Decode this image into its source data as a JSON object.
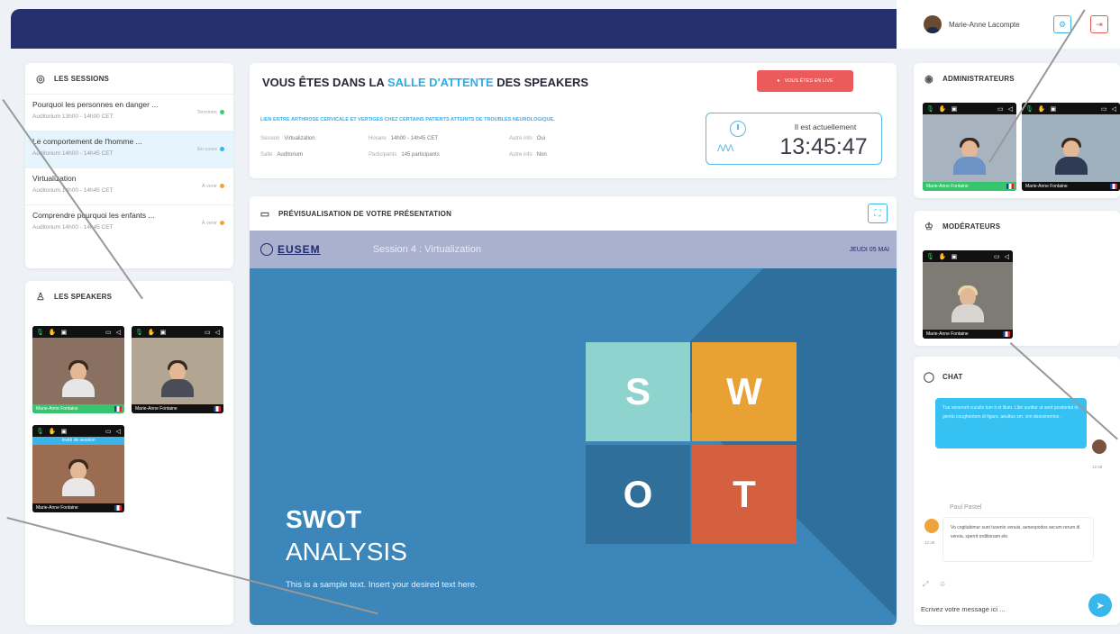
{
  "user": {
    "name": "Marie-Anne Lacompte"
  },
  "sessions": {
    "title": "LES SESSIONS",
    "items": [
      {
        "title": "Pourquoi les personnes en danger ...",
        "meta": "Auditorium  13h00 - 14h00 CET",
        "status": "Terminée",
        "status_color": "#3dc97d"
      },
      {
        "title": "Le comportement de l'homme ...",
        "meta": "Auditorium  14h00 - 14h45 CET",
        "status": "En cours",
        "status_color": "#3ab4e6"
      },
      {
        "title": "Virtualization",
        "meta": "Auditorium  14h00 - 14h45 CET",
        "status": "À venir",
        "status_color": "#f0a33a"
      },
      {
        "title": "Comprendre pourquoi les enfants ...",
        "meta": "Auditorium  14h00 - 14h45 CET",
        "status": "À venir",
        "status_color": "#f0a33a"
      }
    ]
  },
  "speakers": {
    "title": "LES SPEAKERS",
    "tiles": [
      {
        "name": "Marie-Anne Fontaine",
        "highlight": true
      },
      {
        "name": "Marie-Anne Fontaine",
        "highlight": false
      },
      {
        "name": "Marie-Anne Fontaine",
        "highlight": false,
        "top_label": "Invité de session"
      }
    ]
  },
  "main": {
    "title_pre": "VOUS ÊTES DANS LA ",
    "title_highlight": "SALLE D'ATTENTE",
    "title_post": " DES SPEAKERS",
    "live_button": "VOUS ÊTES EN LIVE",
    "topic": "LIEN ENTRE ARTHROSE CERVICALE ET VERTIGES CHEZ CERTAINS PATIENTS ATTEINTS DE TROUBLES NEUROLOGIQUE.",
    "meta": [
      {
        "label": "Session",
        "value": "Virtualization"
      },
      {
        "label": "Horaire",
        "value": "14h00 - 14h45 CET"
      },
      {
        "label": "Autre info",
        "value": "Oui"
      },
      {
        "label": "Salle",
        "value": "Auditorium"
      },
      {
        "label": "Participants",
        "value": "145 participants"
      },
      {
        "label": "Autre info",
        "value": "Non"
      }
    ],
    "clock_label": "Il est actuellement",
    "clock_time": "13:45:47"
  },
  "preview": {
    "title": "PRÉVISUALISATION DE VOTRE PRÉSENTATION",
    "logo": "EUSEM",
    "session_name": "Session 4 : Virtualization",
    "date": "JEUDI 05 MAI",
    "slide_title1": "SWOT",
    "slide_title2": "ANALYSIS",
    "slide_text": "This is a sample text. Insert your desired text here.",
    "letters": [
      "S",
      "W",
      "O",
      "T"
    ],
    "colors": [
      "#8ed3cd",
      "#e8a234",
      "#2f6f9a",
      "#d4603f"
    ]
  },
  "admins": {
    "title": "ADMINISTRATEURS",
    "tiles": [
      {
        "name": "Marie-Anne Fontaine",
        "highlight": true
      },
      {
        "name": "Marie-Anne Fontaine",
        "highlight": false
      }
    ]
  },
  "moderators": {
    "title": "MODÉRATEURS",
    "tiles": [
      {
        "name": "Marie-Anne Fontaine",
        "highlight": false
      }
    ]
  },
  "chat": {
    "title": "CHAT",
    "msg1": "Tua venerunt cucullo tum ti et illum. Libri sunttur ut sent positentui in. genitu coughentem di figuro, aeuituo sm. vim descenentos .",
    "msg1_time": "12:48",
    "sender2": "Paul Pastel",
    "msg2": "Vo cogitabimur sunt tuvenio venuis, aeneopodos secum rerum di vereia, sperrit orditionam ele.",
    "msg2_time": "12:36",
    "placeholder": "Ecrivez votre message ici ..."
  }
}
